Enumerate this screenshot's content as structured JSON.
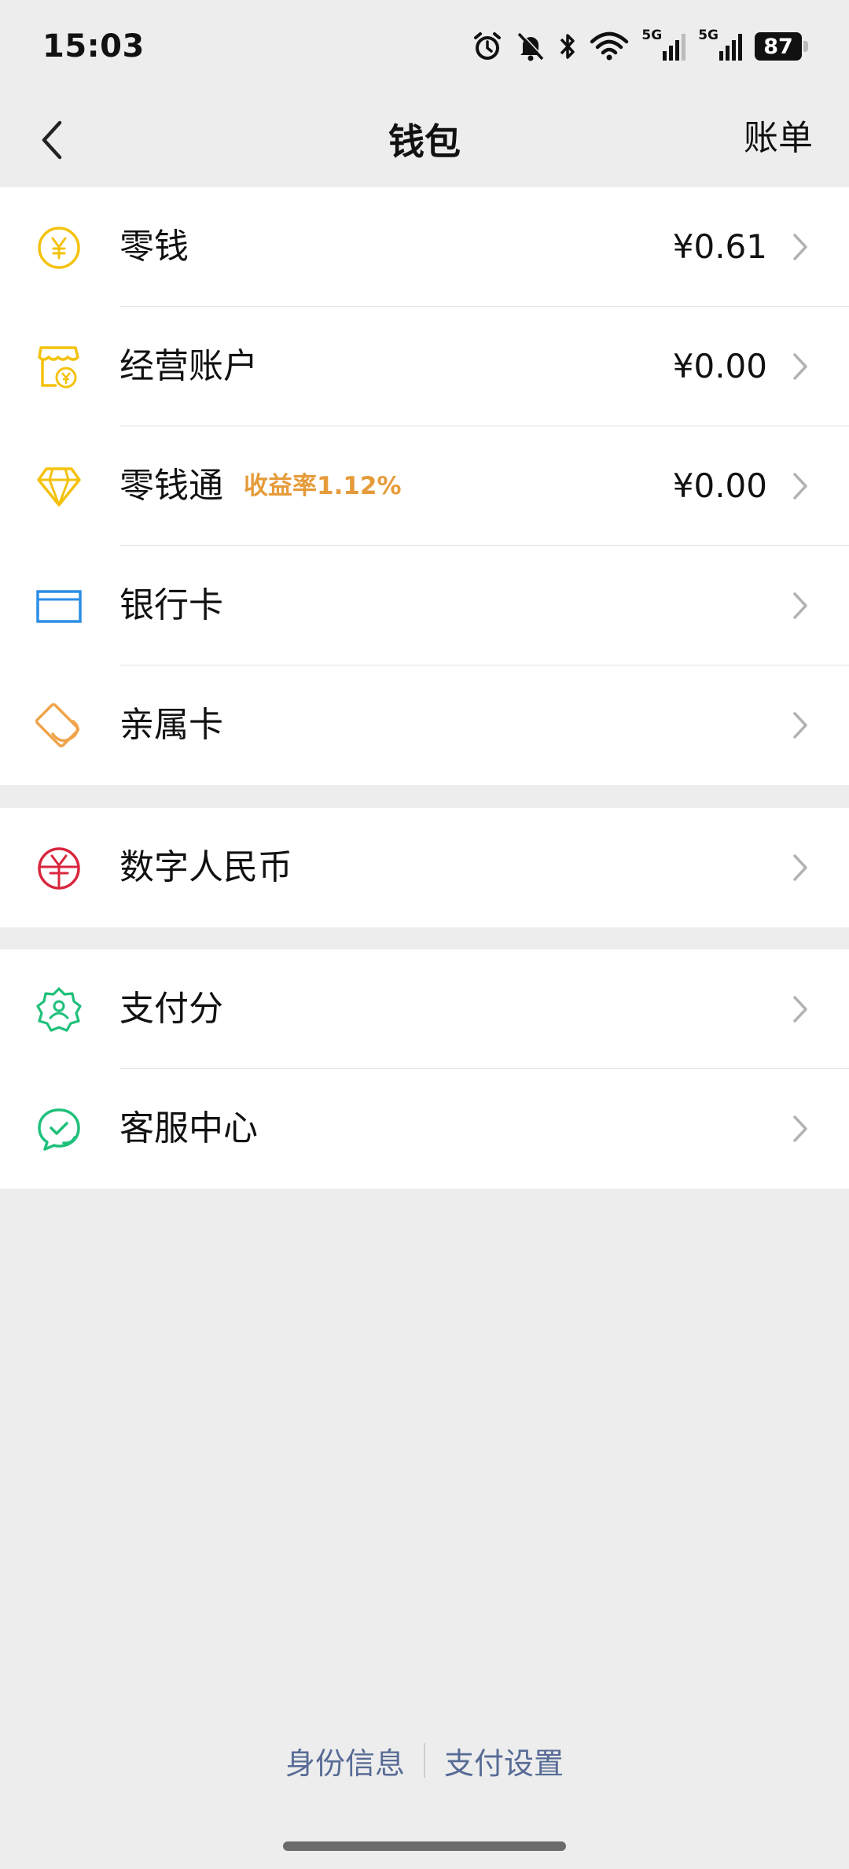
{
  "status_bar": {
    "time": "15:03",
    "network_1": "5G",
    "network_2": "5G",
    "battery": "87"
  },
  "nav": {
    "title": "钱包",
    "right_label": "账单"
  },
  "groups": [
    {
      "items": [
        {
          "label": "零钱",
          "value": "¥0.61",
          "icon": "yuan-coin-icon",
          "color": "#f4c20d"
        },
        {
          "label": "经营账户",
          "value": "¥0.00",
          "icon": "shop-icon",
          "color": "#f4c20d"
        },
        {
          "label": "零钱通",
          "tag": "收益率1.12%",
          "value": "¥0.00",
          "icon": "diamond-icon",
          "color": "#f4c20d"
        },
        {
          "label": "银行卡",
          "icon": "bank-card-icon",
          "color": "#2b8ee6"
        },
        {
          "label": "亲属卡",
          "icon": "family-card-icon",
          "color": "#f0a44a"
        }
      ]
    },
    {
      "items": [
        {
          "label": "数字人民币",
          "icon": "digital-rmb-icon",
          "color": "#d9263e"
        }
      ]
    },
    {
      "items": [
        {
          "label": "支付分",
          "icon": "payment-score-icon",
          "color": "#1fc07a"
        },
        {
          "label": "客服中心",
          "icon": "customer-service-icon",
          "color": "#1fc07a"
        }
      ]
    }
  ],
  "footer": {
    "identity_link": "身份信息",
    "settings_link": "支付设置"
  },
  "colors": {
    "link": "#576b95",
    "tag": "#e69b3a",
    "background": "#ededed"
  }
}
